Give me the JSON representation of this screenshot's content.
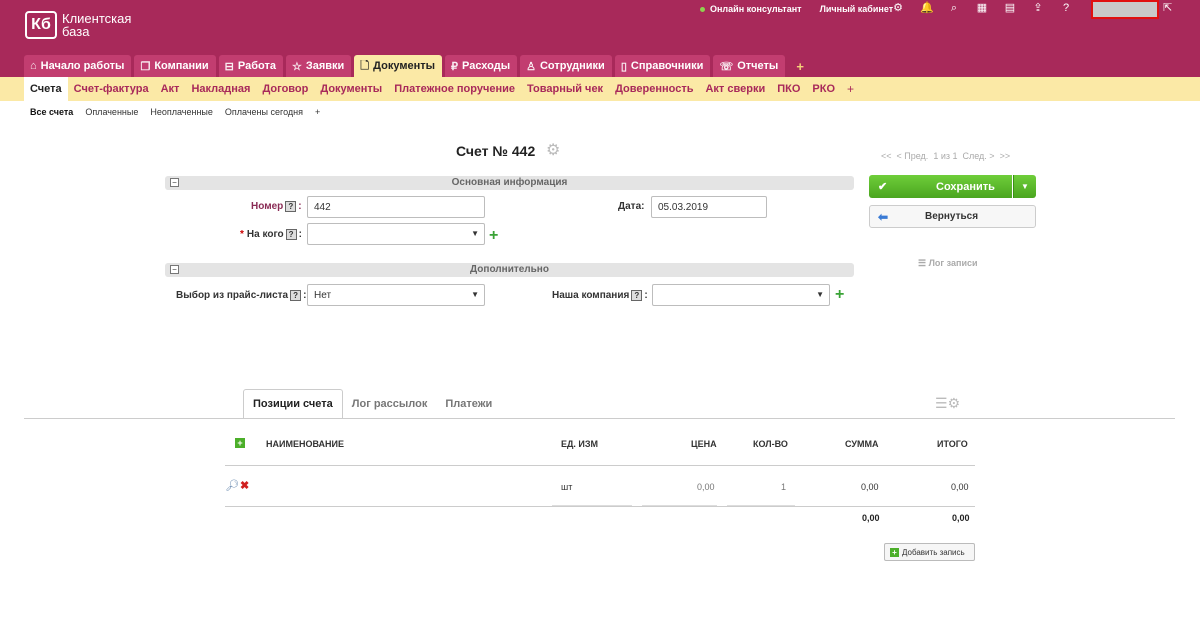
{
  "app": {
    "logo_mark": "Кб",
    "logo_line1": "Клиентская",
    "logo_line2": "база"
  },
  "top_bar": {
    "online_consultant": "Онлайн консультант",
    "personal_account": "Личный кабинет"
  },
  "main_tabs": [
    {
      "label": "Начало работы",
      "icon": "home-icon"
    },
    {
      "label": "Компании",
      "icon": "copy-icon"
    },
    {
      "label": "Работа",
      "icon": "briefcase-icon"
    },
    {
      "label": "Заявки",
      "icon": "star-icon"
    },
    {
      "label": "Документы",
      "icon": "document-icon"
    },
    {
      "label": "Расходы",
      "icon": "money-icon"
    },
    {
      "label": "Сотрудники",
      "icon": "people-icon"
    },
    {
      "label": "Справочники",
      "icon": "book-icon"
    },
    {
      "label": "Отчеты",
      "icon": "chat-icon"
    }
  ],
  "main_tabs_plus": "+",
  "sub_tabs": [
    "Счета",
    "Счет-фактура",
    "Акт",
    "Накладная",
    "Договор",
    "Документы",
    "Платежное поручение",
    "Товарный чек",
    "Доверенность",
    "Акт сверки",
    "ПКО",
    "РКО"
  ],
  "sub_tabs_plus": "+",
  "filters": [
    "Все счета",
    "Оплаченные",
    "Неоплаченные",
    "Оплачены сегодня",
    "+"
  ],
  "doc_title": "Счет № 442",
  "sections": {
    "main": "Основная информация",
    "extra": "Дополнительно"
  },
  "form": {
    "number_label": "Номер",
    "number_value": "442",
    "date_label": "Дата:",
    "date_value": "05.03.2019",
    "to_whom_label": "На кого",
    "to_whom_value": "",
    "price_list_label": "Выбор из прайс-листа",
    "price_list_value": "Нет",
    "our_company_label": "Наша компания",
    "our_company_value": ""
  },
  "pager": {
    "first": "<<",
    "prev": "< Пред.",
    "info": "1 из 1",
    "next": "След. >",
    "last": ">>"
  },
  "buttons": {
    "save": "Сохранить",
    "back": "Вернуться",
    "log": "Лог записи",
    "add_record": "Добавить запись"
  },
  "bottom_tabs": [
    "Позиции счета",
    "Лог рассылок",
    "Платежи"
  ],
  "table": {
    "headers": {
      "name": "НАИМЕНОВАНИЕ",
      "unit": "ЕД. ИЗМ",
      "price": "ЦЕНА",
      "qty": "КОЛ-ВО",
      "sum": "СУММА",
      "total": "ИТОГО"
    },
    "rows": [
      {
        "name": "",
        "unit": "шт",
        "price": "0,00",
        "qty": "1",
        "sum": "0,00",
        "total": "0,00"
      }
    ],
    "totals": {
      "sum": "0,00",
      "total": "0,00"
    }
  }
}
